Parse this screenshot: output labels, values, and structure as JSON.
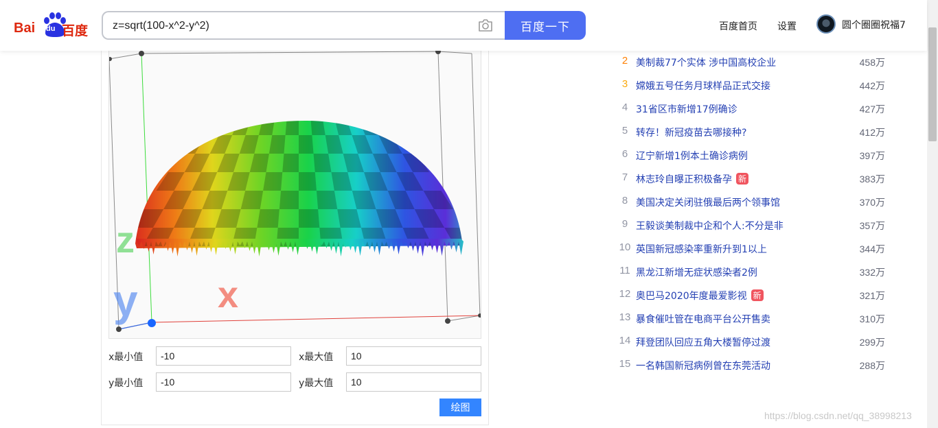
{
  "header": {
    "logo_text_1": "Bai",
    "logo_text_2": "du",
    "logo_text_3": "百度",
    "search_value": "z=sqrt(100-x^2-y^2)",
    "search_button": "百度一下",
    "nav_home": "百度首页",
    "nav_settings": "设置",
    "username": "圆个圈圈祝福7"
  },
  "plot": {
    "axis_labels": {
      "x": "x",
      "y": "y",
      "z": "z"
    },
    "form": {
      "x_min_label": "x最小值",
      "x_min_value": "-10",
      "x_max_label": "x最大值",
      "x_max_value": "10",
      "y_min_label": "y最小值",
      "y_min_value": "-10",
      "y_max_label": "y最大值",
      "y_max_value": "10",
      "draw_button": "绘图"
    }
  },
  "hot_list": [
    {
      "rank": "2",
      "title": "美制裁77个实体 涉中国高校企业",
      "count": "458万",
      "badge": ""
    },
    {
      "rank": "3",
      "title": "嫦娥五号任务月球样品正式交接",
      "count": "442万",
      "badge": ""
    },
    {
      "rank": "4",
      "title": "31省区市新增17例确诊",
      "count": "427万",
      "badge": ""
    },
    {
      "rank": "5",
      "title": "转存！新冠疫苗去哪接种?",
      "count": "412万",
      "badge": ""
    },
    {
      "rank": "6",
      "title": "辽宁新增1例本土确诊病例",
      "count": "397万",
      "badge": ""
    },
    {
      "rank": "7",
      "title": "林志玲自曝正积极备孕",
      "count": "383万",
      "badge": "新"
    },
    {
      "rank": "8",
      "title": "美国决定关闭驻俄最后两个领事馆",
      "count": "370万",
      "badge": ""
    },
    {
      "rank": "9",
      "title": "王毅谈美制裁中企和个人:不分是非",
      "count": "357万",
      "badge": ""
    },
    {
      "rank": "10",
      "title": "英国新冠感染率重新升到1以上",
      "count": "344万",
      "badge": ""
    },
    {
      "rank": "11",
      "title": "黑龙江新增无症状感染者2例",
      "count": "332万",
      "badge": ""
    },
    {
      "rank": "12",
      "title": "奥巴马2020年度最爱影视",
      "count": "321万",
      "badge": "新"
    },
    {
      "rank": "13",
      "title": "暴食催吐管在电商平台公开售卖",
      "count": "310万",
      "badge": ""
    },
    {
      "rank": "14",
      "title": "拜登团队回应五角大楼暂停过渡",
      "count": "299万",
      "badge": ""
    },
    {
      "rank": "15",
      "title": "一名韩国新冠病例曾在东莞活动",
      "count": "288万",
      "badge": ""
    }
  ],
  "watermark": "https://blog.csdn.net/qq_38998213",
  "colors": {
    "accent": "#4e6ef2",
    "link": "#2440b3",
    "badge": "#f0555f",
    "draw_button": "#3385ff"
  },
  "icons": {
    "camera": "camera-icon",
    "logo_paw": "baidu-paw-icon"
  }
}
